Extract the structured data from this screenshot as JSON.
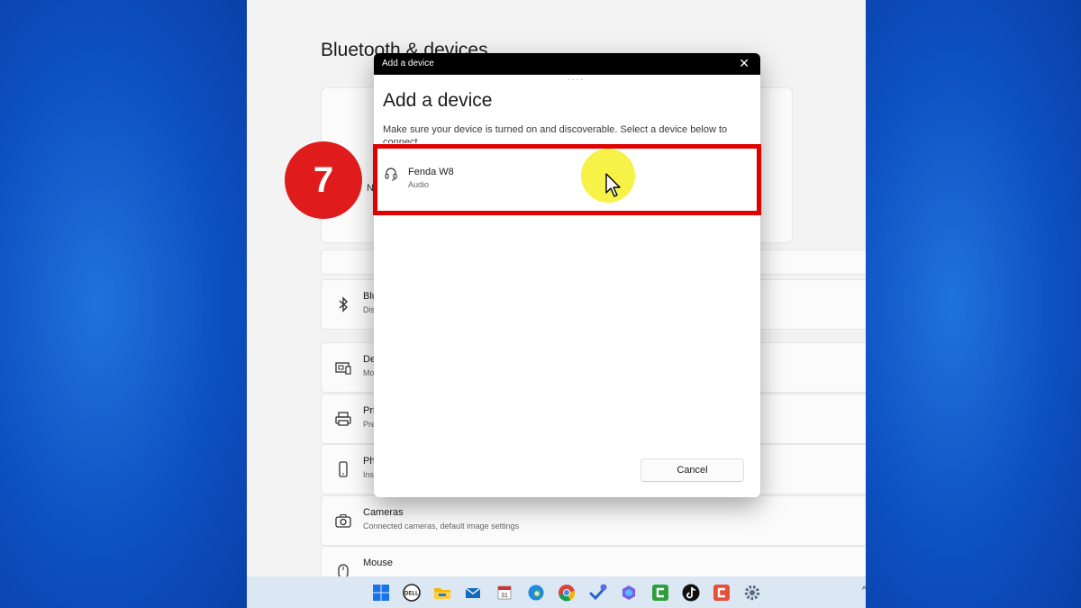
{
  "settings": {
    "title": "Bluetooth & devices",
    "hero_partial": "N",
    "rows": [
      {
        "icon": "bluetooth-icon",
        "title": "Blu",
        "sub": "Dis"
      },
      {
        "icon": "devices-icon",
        "title": "De",
        "sub": "Mo"
      },
      {
        "icon": "printer-icon",
        "title": "Pri",
        "sub": "Pre"
      },
      {
        "icon": "phone-icon",
        "title": "Ph",
        "sub": "Ins"
      },
      {
        "icon": "camera-icon",
        "title": "Cameras",
        "sub": "Connected cameras, default image settings"
      },
      {
        "icon": "mouse-icon",
        "title": "Mouse",
        "sub": ""
      }
    ]
  },
  "dialog": {
    "window_title": "Add a device",
    "close_glyph": "✕",
    "dots": "....",
    "heading": "Add a device",
    "subtitle": "Make sure your device is turned on and discoverable. Select a device below to connect.",
    "devices": [
      {
        "name": "Fenda W8",
        "type": "Audio",
        "icon": "headset-icon"
      }
    ],
    "cancel_label": "Cancel"
  },
  "annotation": {
    "step_number": "7",
    "highlight_color": "#e00000",
    "badge_color": "#e01b1b"
  },
  "taskbar": {
    "icons": [
      "windows-start-icon",
      "dell-icon",
      "file-explorer-icon",
      "mail-icon",
      "calendar-icon",
      "edge-icon",
      "chrome-icon",
      "todo-icon",
      "copilot-icon",
      "camtasia-icon",
      "tiktok-icon",
      "capcut-icon",
      "settings-icon"
    ],
    "tray_glyph": "^"
  }
}
